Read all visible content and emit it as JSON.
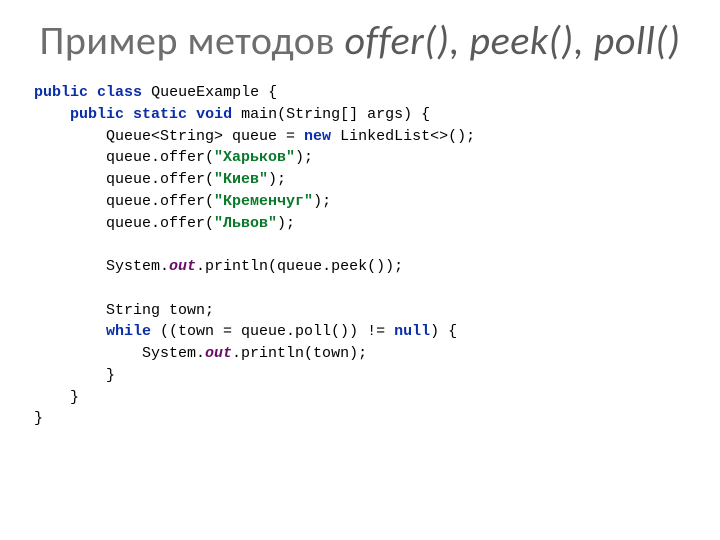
{
  "title": {
    "pre": "Пример методов ",
    "ital": "offer(), peek(), poll()"
  },
  "code": {
    "kw_public": "public",
    "kw_class": "class",
    "cls_name": "QueueExample",
    "kw_static": "static",
    "kw_void": "void",
    "m_main": "main",
    "sig_args": "(String[] args) {",
    "l_queue_decl_a": "        Queue<String> queue = ",
    "kw_new": "new",
    "l_queue_decl_b": " LinkedList<>();",
    "l_offer_open": "        queue.offer(",
    "s_kharkov": "\"Харьков\"",
    "s_kiev": "\"Киев\"",
    "s_kremenchug": "\"Кременчуг\"",
    "s_lvov": "\"Львов\"",
    "close_stmt": ");",
    "l_peek_a": "        System.",
    "fld_out": "out",
    "l_peek_b": ".println(queue.peek());",
    "l_decl_town": "        String town;",
    "kw_while": "while",
    "l_while_cond_a": " ((town = queue.poll()) != ",
    "kw_null": "null",
    "l_while_cond_b": ") {",
    "l_println_town_a": "            System.",
    "l_println_town_b": ".println(town);",
    "brace_close8": "        }",
    "brace_close4": "    }",
    "brace_close0": "}"
  }
}
